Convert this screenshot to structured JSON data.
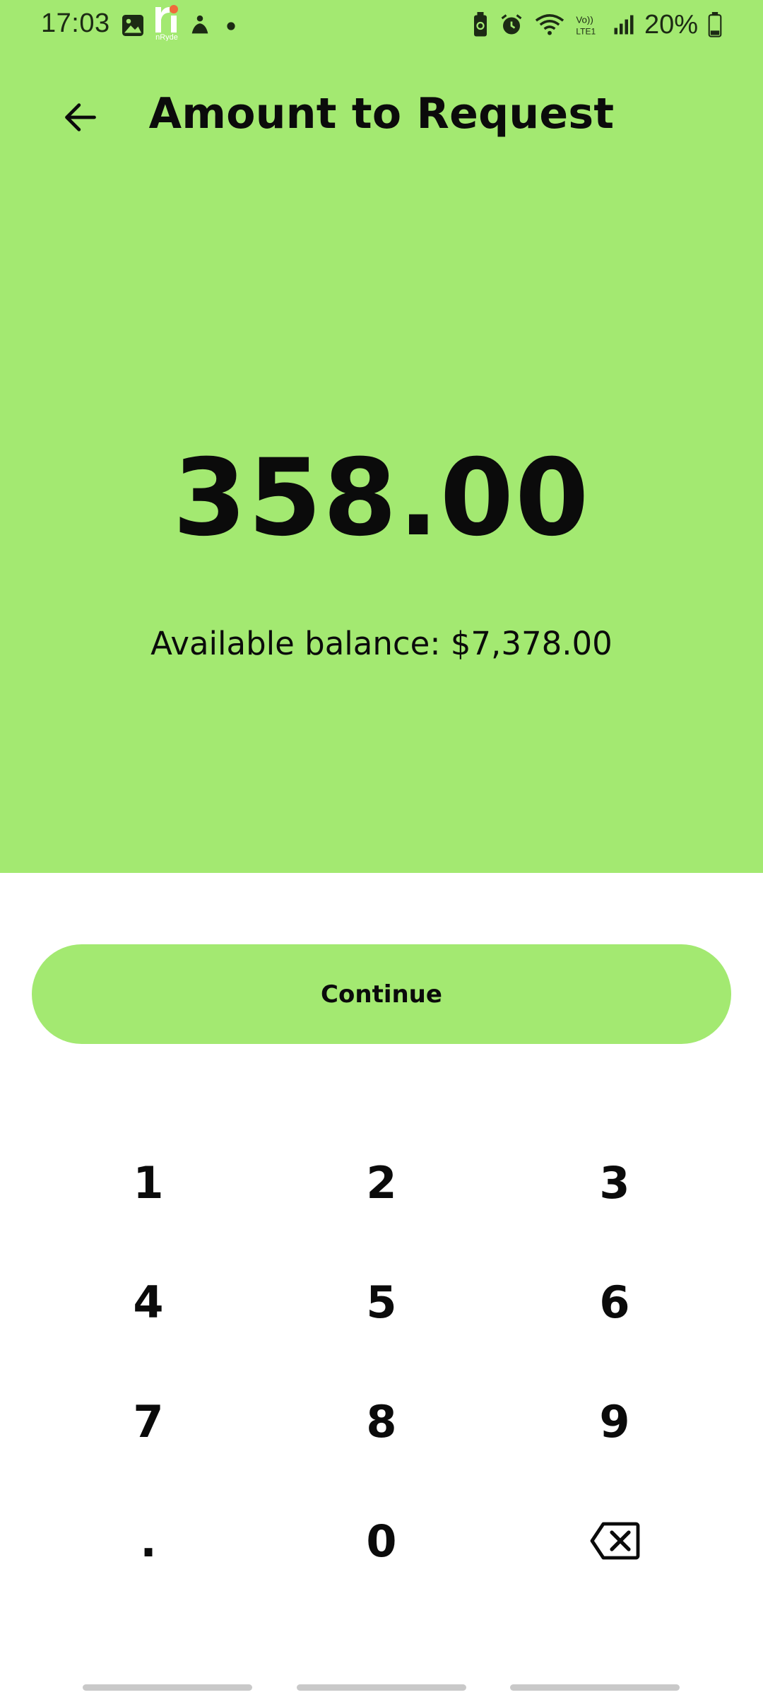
{
  "status_bar": {
    "time": "17:03",
    "battery_percent": "20%",
    "left_icons": [
      "image-icon",
      "nryde-app-icon",
      "person-notification-icon",
      "dot-icon"
    ],
    "right_icons": [
      "battery-saver-icon",
      "alarm-icon",
      "wifi-icon",
      "volte-icon",
      "signal-icon",
      "battery-icon"
    ],
    "app_badge_text": "nRyde"
  },
  "header": {
    "title": "Amount to Request",
    "back_icon": "arrow-left-icon"
  },
  "amount": {
    "value": "358.00",
    "available_balance": "Available balance: $7,378.00"
  },
  "continue_button": {
    "label": "Continue"
  },
  "keypad": {
    "keys": [
      "1",
      "2",
      "3",
      "4",
      "5",
      "6",
      "7",
      "8",
      "9",
      ".",
      "0"
    ],
    "backspace_icon": "backspace-icon"
  },
  "colors": {
    "accent": "#a3e971",
    "text": "#0b0b0b",
    "background": "#ffffff"
  }
}
